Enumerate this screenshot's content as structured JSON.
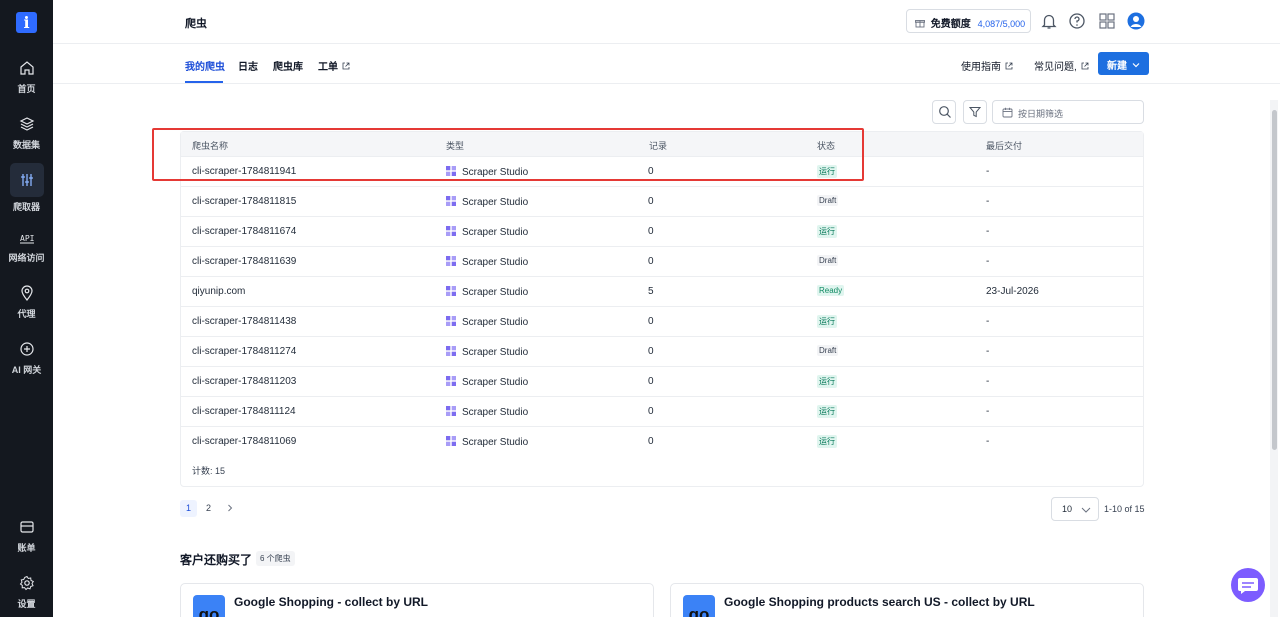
{
  "sidebar": {
    "items": [
      {
        "label": "首页",
        "icon": "home-icon"
      },
      {
        "label": "数据集",
        "icon": "layers-icon"
      },
      {
        "label": "爬取器",
        "icon": "scraper-icon"
      },
      {
        "label": "网络访问",
        "icon": "api-icon"
      },
      {
        "label": "代理",
        "icon": "location-pin-icon"
      },
      {
        "label": "AI 网关",
        "icon": "ai-gateway-icon"
      }
    ],
    "bottom_items": [
      {
        "label": "账单",
        "icon": "card-icon"
      },
      {
        "label": "设置",
        "icon": "gear-icon"
      }
    ]
  },
  "header": {
    "title": "爬虫",
    "credit_label": "免费额度",
    "credit_value": "4,087/5,000"
  },
  "tabs": [
    {
      "label": "我的爬虫"
    },
    {
      "label": "日志"
    },
    {
      "label": "爬虫库"
    },
    {
      "label": "工单"
    }
  ],
  "links": {
    "guide": "使用指南",
    "faq": "常见问题,",
    "new_button": "新建"
  },
  "filter": {
    "date_placeholder": "按日期筛选"
  },
  "table": {
    "columns": [
      "爬虫名称",
      "类型",
      "记录",
      "状态",
      "最后交付"
    ],
    "rows": [
      {
        "name": "cli-scraper-1784811941",
        "type": "Scraper Studio",
        "records": "0",
        "status": "运行",
        "delivered": "-"
      },
      {
        "name": "cli-scraper-1784811815",
        "type": "Scraper Studio",
        "records": "0",
        "status": "Draft",
        "delivered": "-"
      },
      {
        "name": "cli-scraper-1784811674",
        "type": "Scraper Studio",
        "records": "0",
        "status": "运行",
        "delivered": "-"
      },
      {
        "name": "cli-scraper-1784811639",
        "type": "Scraper Studio",
        "records": "0",
        "status": "Draft",
        "delivered": "-"
      },
      {
        "name": "qiyunip.com",
        "type": "Scraper Studio",
        "records": "5",
        "status": "Ready",
        "delivered": "23-Jul-2026"
      },
      {
        "name": "cli-scraper-1784811438",
        "type": "Scraper Studio",
        "records": "0",
        "status": "运行",
        "delivered": "-"
      },
      {
        "name": "cli-scraper-1784811274",
        "type": "Scraper Studio",
        "records": "0",
        "status": "Draft",
        "delivered": "-"
      },
      {
        "name": "cli-scraper-1784811203",
        "type": "Scraper Studio",
        "records": "0",
        "status": "运行",
        "delivered": "-"
      },
      {
        "name": "cli-scraper-1784811124",
        "type": "Scraper Studio",
        "records": "0",
        "status": "运行",
        "delivered": "-"
      },
      {
        "name": "cli-scraper-1784811069",
        "type": "Scraper Studio",
        "records": "0",
        "status": "运行",
        "delivered": "-"
      }
    ],
    "count_text": "计数: 15"
  },
  "pagination": {
    "pages": [
      "1",
      "2"
    ],
    "page_size": "10",
    "range": "1-10 of 15"
  },
  "related": {
    "title": "客户还购买了",
    "badge": "6 个爬虫",
    "cards": [
      {
        "thumb": "go",
        "title": "Google Shopping - collect by URL"
      },
      {
        "thumb": "go",
        "title": "Google Shopping products search US - collect by URL"
      }
    ]
  },
  "colors": {
    "accent": "#1d6fe0",
    "sidebar_bg": "#14181f",
    "highlight": "#e53935"
  }
}
